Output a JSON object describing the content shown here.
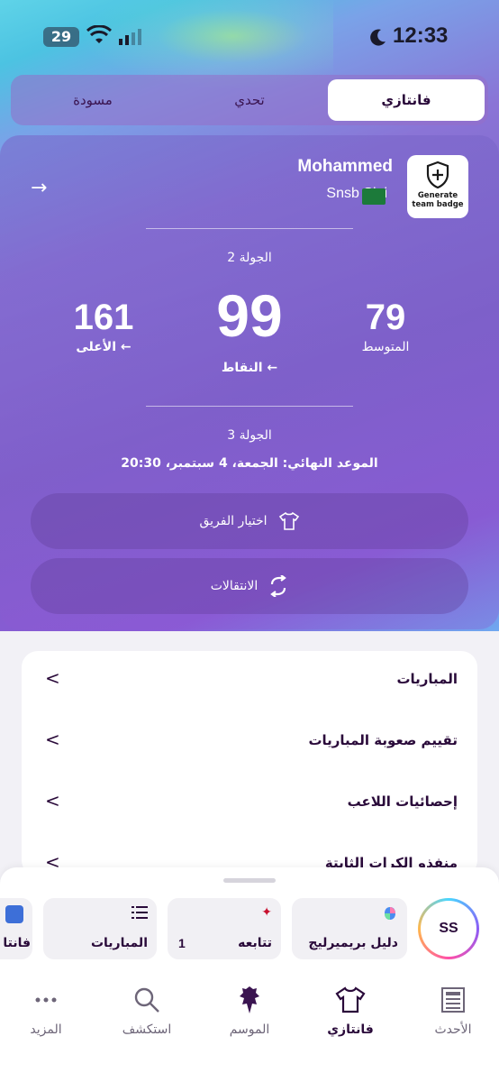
{
  "status_bar": {
    "time": "12:33",
    "battery": "29"
  },
  "tabs": [
    {
      "label": "فانتازي",
      "active": true
    },
    {
      "label": "تحدي",
      "active": false
    },
    {
      "label": "مسودة",
      "active": false
    }
  ],
  "team_card": {
    "manager_name": "Mohammed",
    "team_name": "Snsb Sjei",
    "badge_cta": "Generate team badge",
    "current_gameweek": "الجولة 2",
    "stats": {
      "highest": {
        "value": "161",
        "label": "الأعلى ←"
      },
      "points": {
        "value": "99",
        "label": "النقاط ←"
      },
      "average": {
        "value": "79",
        "label": "المتوسط"
      }
    },
    "next_gameweek": "الجولة 3",
    "deadline": "الموعد النهائي: الجمعة، 4 سبتمبر، 20:30",
    "pick_team_label": "اختيار الفريق",
    "transfers_label": "الانتقالات"
  },
  "menu": [
    {
      "label": "المباريات"
    },
    {
      "label": "تقييم صعوبة المباريات"
    },
    {
      "label": "إحصائيات اللاعب"
    },
    {
      "label": "منفذو الكرات الثابتة"
    }
  ],
  "shortcuts": {
    "avatar_initials": "SS",
    "guide_label": "دليل بريميرليج",
    "following_label": "تتابعه",
    "following_count": "1",
    "matches_label": "المباريات",
    "partial_label": "فانتا"
  },
  "bottom_nav": [
    {
      "label": "الأحدث",
      "icon": "news-icon"
    },
    {
      "label": "فانتازي",
      "icon": "shirt-icon",
      "active": true
    },
    {
      "label": "الموسم",
      "icon": "premier-league-lion-icon"
    },
    {
      "label": "استكشف",
      "icon": "search-icon"
    },
    {
      "label": "المزيد",
      "icon": "more-dots-icon"
    }
  ],
  "colors": {
    "accent_dark": "#2a0a3a",
    "card_purple": "#7d5fc8",
    "flag_green": "#1c7a3a"
  }
}
